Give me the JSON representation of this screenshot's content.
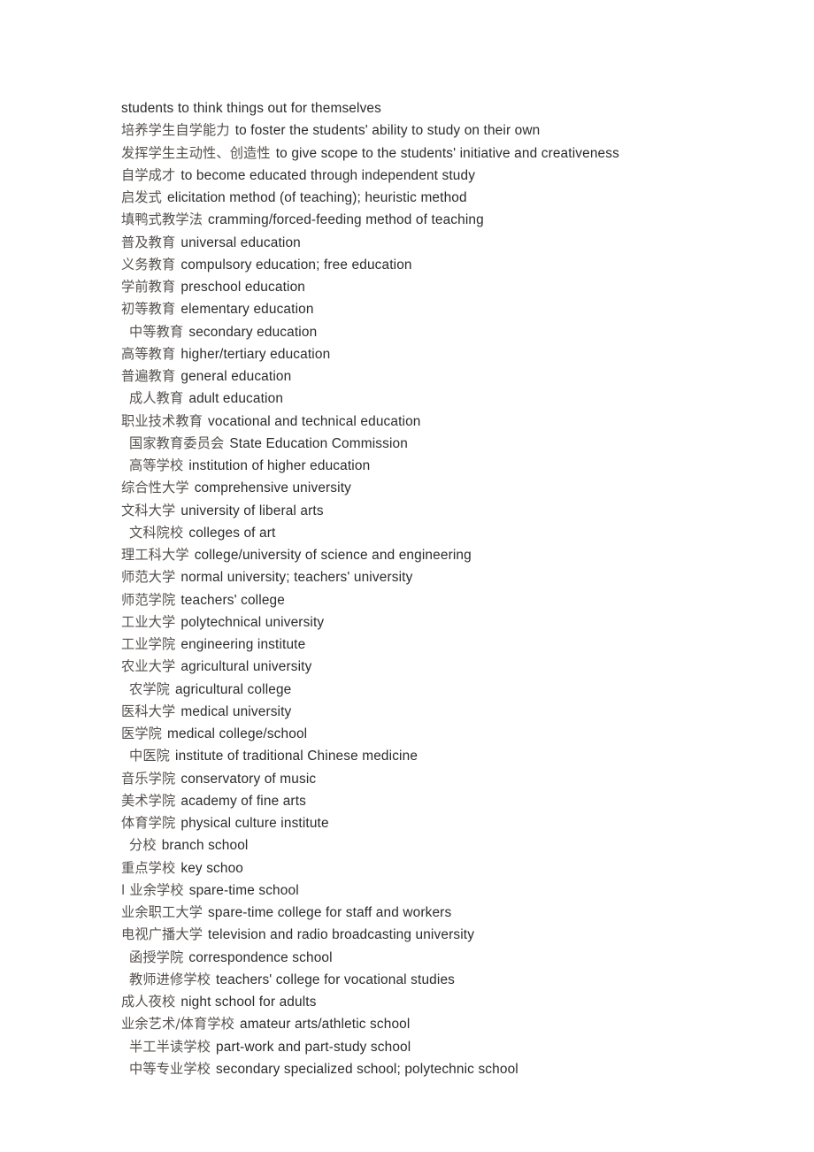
{
  "document": {
    "background_color": "#ffffff",
    "chinese_text_color": "#55504d",
    "english_text_color": "#2b2b2b",
    "entries": [
      {
        "zh": "",
        "en": "students to think things out for themselves",
        "indent": 0
      },
      {
        "zh": "培养学生自学能力",
        "en": "to foster the students' ability to study on their own",
        "indent": 0
      },
      {
        "zh": "发挥学生主动性、创造性",
        "en": "to give scope to the students' initiative and creativeness",
        "indent": 0
      },
      {
        "zh": "自学成才",
        "en": "to become educated through independent study",
        "indent": 0
      },
      {
        "zh": "启发式",
        "en": "elicitation method (of teaching); heuristic method",
        "indent": 0
      },
      {
        "zh": "填鸭式教学法",
        "en": "cramming/forced-feeding method of teaching",
        "indent": 0
      },
      {
        "zh": "普及教育",
        "en": "universal education",
        "indent": 0
      },
      {
        "zh": "义务教育",
        "en": "compulsory education; free education",
        "indent": 0
      },
      {
        "zh": "学前教育",
        "en": "preschool education",
        "indent": 0
      },
      {
        "zh": "初等教育",
        "en": "elementary education",
        "indent": 0
      },
      {
        "zh": "中等教育",
        "en": "secondary education",
        "indent": 1
      },
      {
        "zh": "高等教育",
        "en": "higher/tertiary education",
        "indent": 0
      },
      {
        "zh": "普遍教育",
        "en": "general education",
        "indent": 0
      },
      {
        "zh": "成人教育",
        "en": "adult education",
        "indent": 1
      },
      {
        "zh": "职业技术教育",
        "en": "vocational and technical education",
        "indent": 0
      },
      {
        "zh": "国家教育委员会",
        "en": "State Education Commission",
        "indent": 1
      },
      {
        "zh": "高等学校",
        "en": "institution of higher education",
        "indent": 1
      },
      {
        "zh": "综合性大学",
        "en": "comprehensive university",
        "indent": 0
      },
      {
        "zh": "文科大学",
        "en": "university of liberal arts",
        "indent": 0
      },
      {
        "zh": "文科院校",
        "en": "colleges of art",
        "indent": 1
      },
      {
        "zh": "理工科大学",
        "en": "college/university of science and engineering",
        "indent": 0
      },
      {
        "zh": "师范大学",
        "en": "normal university; teachers' university",
        "indent": 0
      },
      {
        "zh": "师范学院",
        "en": "teachers' college",
        "indent": 0
      },
      {
        "zh": "工业大学",
        "en": "polytechnical university",
        "indent": 0
      },
      {
        "zh": "工业学院",
        "en": "engineering institute",
        "indent": 0
      },
      {
        "zh": "农业大学",
        "en": "agricultural university",
        "indent": 0
      },
      {
        "zh": "农学院",
        "en": "agricultural college",
        "indent": 1
      },
      {
        "zh": "医科大学",
        "en": "medical university",
        "indent": 0
      },
      {
        "zh": "医学院",
        "en": "medical college/school",
        "indent": 0
      },
      {
        "zh": "中医院",
        "en": "institute of traditional Chinese medicine",
        "indent": 1
      },
      {
        "zh": "音乐学院",
        "en": "conservatory of music",
        "indent": 0
      },
      {
        "zh": "美术学院",
        "en": "academy of fine arts",
        "indent": 0
      },
      {
        "zh": "体育学院",
        "en": "physical culture institute",
        "indent": 0
      },
      {
        "zh": "分校",
        "en": "branch school",
        "indent": 1
      },
      {
        "zh": "重点学校",
        "en": "key schoo",
        "indent": 0
      },
      {
        "zh": "l 业余学校",
        "en": "spare-time school",
        "indent": 0
      },
      {
        "zh": "业余职工大学",
        "en": "spare-time college for staff and workers",
        "indent": 0
      },
      {
        "zh": "电视广播大学",
        "en": "television and radio broadcasting university",
        "indent": 0
      },
      {
        "zh": "函授学院",
        "en": "correspondence school",
        "indent": 1
      },
      {
        "zh": "教师进修学校",
        "en": "teachers' college for vocational studies",
        "indent": 1
      },
      {
        "zh": "成人夜校",
        "en": "night school for adults",
        "indent": 0
      },
      {
        "zh": "业余艺术/体育学校",
        "en": "amateur arts/athletic school",
        "indent": 0
      },
      {
        "zh": "半工半读学校",
        "en": "part-work and part-study school",
        "indent": 1
      },
      {
        "zh": "中等专业学校",
        "en": "secondary specialized school; polytechnic school",
        "indent": 1
      }
    ]
  }
}
